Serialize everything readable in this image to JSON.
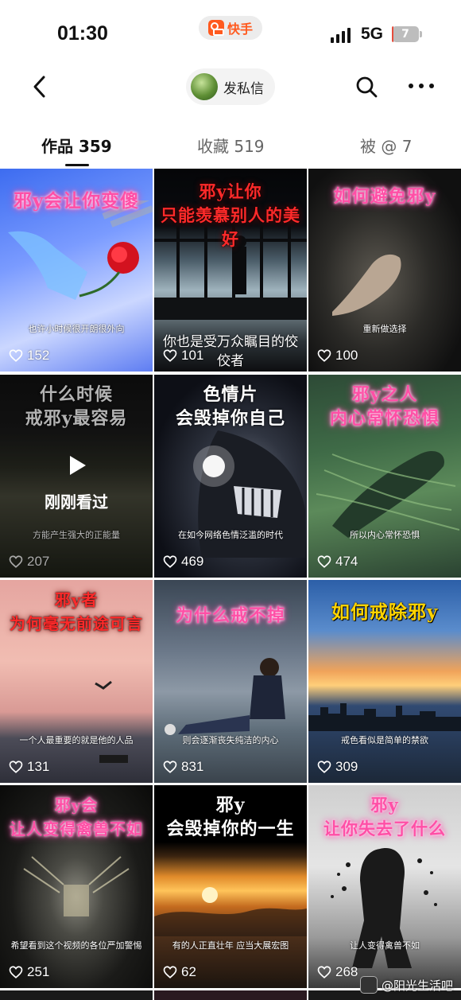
{
  "status_bar": {
    "time": "01:30",
    "app_name": "快手",
    "network": "5G",
    "battery": "7",
    "battery_level_pct": 7
  },
  "nav": {
    "message_label": "发私信"
  },
  "tabs": [
    {
      "label": "作品 359",
      "active": true
    },
    {
      "label": "收藏 519",
      "active": false
    },
    {
      "label": "被 @ 7",
      "active": false
    }
  ],
  "videos": [
    {
      "title": "邪y会让你变傻",
      "caption": "也许小时候很开朗很外向",
      "likes": "152"
    },
    {
      "title": "邪y让你\n只能羡慕别人的美好",
      "caption": "你也是受万众瞩目的佼\n佼者",
      "likes": "101"
    },
    {
      "title": "如何避免邪y",
      "caption": "重新做选择",
      "likes": "100"
    },
    {
      "title": "什么时候\n戒邪y最容易",
      "caption": "方能产生强大的正能量",
      "likes": "207",
      "watched_label": "刚刚看过"
    },
    {
      "title": "色情片\n会毁掉你自己",
      "caption": "在如今网络色情泛滥的时代",
      "likes": "469"
    },
    {
      "title": "邪y之人\n内心常怀恐惧",
      "caption": "所以内心常怀恐惧",
      "likes": "474"
    },
    {
      "title": "邪y者\n为何毫无前途可言",
      "caption": "一个人最重要的就是他的人品",
      "likes": "131"
    },
    {
      "title": "为什么戒不掉",
      "caption": "则会逐渐丧失纯洁的内心",
      "likes": "831"
    },
    {
      "title": "如何戒除邪y",
      "caption": "戒色看似是简单的禁欲",
      "likes": "309"
    },
    {
      "title": "邪y会\n让人变得禽兽不如",
      "caption": "希望看到这个视频的各位严加警惕",
      "likes": "251"
    },
    {
      "title": "邪y\n会毁掉你的一生",
      "caption": "有的人正直壮年 应当大展宏图",
      "likes": "62"
    },
    {
      "title": "邪y\n让你失去了什么",
      "caption": "让人变得禽兽不如",
      "likes": "268"
    }
  ],
  "watermark": "@阳光生活吧",
  "icons": {
    "back": "chevron-left-icon",
    "search": "search-icon",
    "more": "more-horizontal-icon",
    "like": "heart-icon",
    "play": "play-icon"
  }
}
